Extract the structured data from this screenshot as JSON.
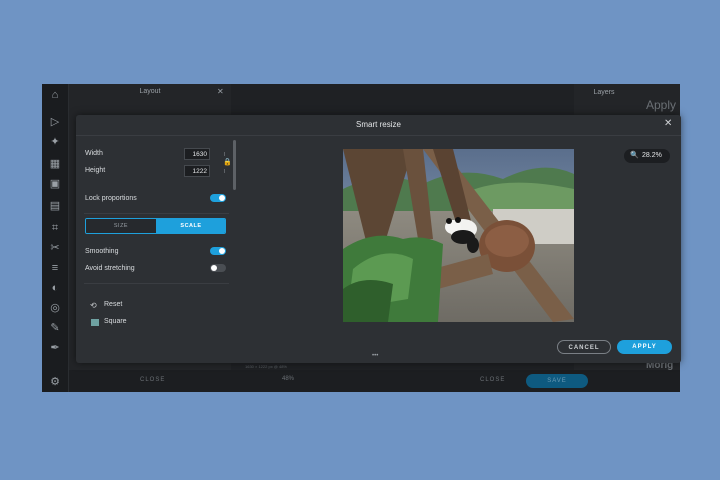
{
  "background_panel": {
    "title": "Layout",
    "layers_label": "Layers",
    "apply_ghost": "Apply",
    "ghost_text": "Morig",
    "bottom": {
      "close_left": "CLOSE",
      "close_right": "CLOSE",
      "save": "SAVE",
      "zoom": "48%",
      "dims": "1630 × 1222 px @ 48%"
    }
  },
  "modal": {
    "title": "Smart resize",
    "close_icon": "close-icon",
    "width_label": "Width",
    "width_value": "1630",
    "height_label": "Height",
    "height_value": "1222",
    "lock_proportions_label": "Lock proportions",
    "lock_proportions_on": true,
    "mode_size": "SIZE",
    "mode_scale": "SCALE",
    "smoothing_label": "Smoothing",
    "smoothing_on": true,
    "avoid_stretching_label": "Avoid stretching",
    "avoid_stretching_on": false,
    "reset_label": "Reset",
    "square_label": "Square",
    "zoom_level": "28.2%",
    "more": "•••",
    "cancel": "CANCEL",
    "apply": "APPLY"
  },
  "colors": {
    "accent": "#1ea0dc",
    "page_bg": "#6f94c4",
    "modal_bg": "#2d3034",
    "square_swatch": "#6fa2a2"
  }
}
